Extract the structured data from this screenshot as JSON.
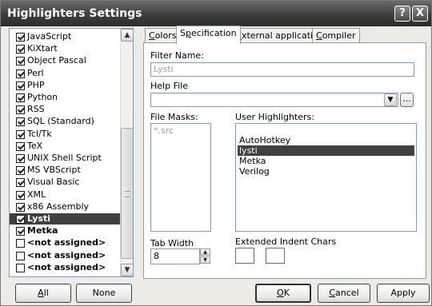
{
  "window": {
    "title": "Highlighters Settings",
    "help_label": "?",
    "close_label": "X"
  },
  "languages": [
    {
      "label": "JavaScript",
      "checked": true,
      "bold": false,
      "selected": false
    },
    {
      "label": "KiXtart",
      "checked": true,
      "bold": false,
      "selected": false
    },
    {
      "label": "Object Pascal",
      "checked": true,
      "bold": false,
      "selected": false
    },
    {
      "label": "Perl",
      "checked": true,
      "bold": false,
      "selected": false
    },
    {
      "label": "PHP",
      "checked": true,
      "bold": false,
      "selected": false
    },
    {
      "label": "Python",
      "checked": true,
      "bold": false,
      "selected": false
    },
    {
      "label": "RSS",
      "checked": true,
      "bold": false,
      "selected": false
    },
    {
      "label": "SQL (Standard)",
      "checked": true,
      "bold": false,
      "selected": false
    },
    {
      "label": "Tcl/Tk",
      "checked": true,
      "bold": false,
      "selected": false
    },
    {
      "label": "TeX",
      "checked": true,
      "bold": false,
      "selected": false
    },
    {
      "label": "UNIX Shell Script",
      "checked": true,
      "bold": false,
      "selected": false
    },
    {
      "label": "MS VBScript",
      "checked": true,
      "bold": false,
      "selected": false
    },
    {
      "label": "Visual Basic",
      "checked": true,
      "bold": false,
      "selected": false
    },
    {
      "label": "XML",
      "checked": true,
      "bold": false,
      "selected": false
    },
    {
      "label": "x86 Assembly",
      "checked": true,
      "bold": false,
      "selected": false
    },
    {
      "label": "Lysti",
      "checked": true,
      "bold": true,
      "selected": true
    },
    {
      "label": "Metka",
      "checked": true,
      "bold": true,
      "selected": false
    },
    {
      "label": "<not assigned>",
      "checked": false,
      "bold": true,
      "selected": false
    },
    {
      "label": "<not assigned>",
      "checked": false,
      "bold": true,
      "selected": false
    },
    {
      "label": "<not assigned>",
      "checked": false,
      "bold": true,
      "selected": false
    }
  ],
  "tabs": {
    "colors": {
      "hot": "C",
      "rest": "olors"
    },
    "specification": {
      "pre": "S",
      "hot": "p",
      "rest": "ecification"
    },
    "external": {
      "hot": "E",
      "rest": "xternal applications"
    },
    "compiler": {
      "hot": "C",
      "rest": "ompiler"
    }
  },
  "spec": {
    "filter_name_label": "Filter Name:",
    "filter_name_value": "Lysti",
    "help_file_label": "Help File",
    "help_file_value": "",
    "browse_label": "...",
    "file_masks_label": "File Masks:",
    "file_masks": [
      "*.src"
    ],
    "user_highlighters_label": "User Highlighters:",
    "user_highlighters": [
      {
        "label": "AutoHotkey",
        "selected": false
      },
      {
        "label": "lysti",
        "selected": true
      },
      {
        "label": "Metka",
        "selected": false
      },
      {
        "label": "Verilog",
        "selected": false
      }
    ],
    "tab_width_label": "Tab Width",
    "tab_width_value": "8",
    "extended_indent_label": "Extended Indent Chars"
  },
  "buttons": {
    "all": {
      "hot": "A",
      "rest": "ll"
    },
    "none": "None",
    "ok": {
      "hot": "O",
      "rest": "K"
    },
    "cancel": {
      "hot": "C",
      "rest": "ancel"
    },
    "apply": "Apply"
  },
  "icons": {
    "scroll_up": "▲",
    "scroll_down": "▼",
    "dropdown": "▼",
    "spin_up": "▲",
    "spin_down": "▼"
  }
}
